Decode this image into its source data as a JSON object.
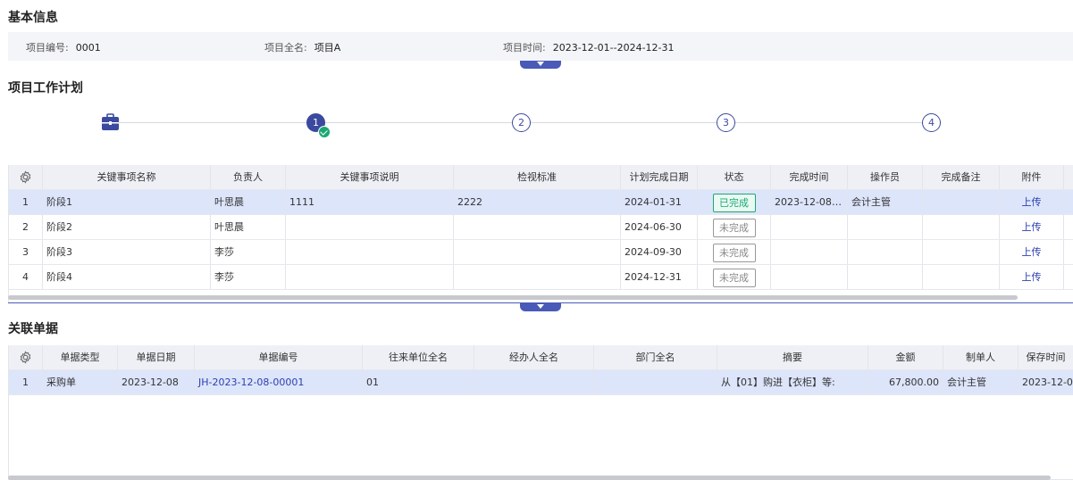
{
  "basic_info": {
    "title": "基本信息",
    "project_code_label": "项目编号:",
    "project_code": "0001",
    "project_name_label": "项目全名:",
    "project_name": "项目A",
    "project_time_label": "项目时间:",
    "project_time": "2023-12-01--2024-12-31"
  },
  "plan": {
    "title": "项目工作计划",
    "steps": [
      "1",
      "2",
      "3",
      "4"
    ],
    "columns": [
      "关键事项名称",
      "负责人",
      "关键事项说明",
      "检视标准",
      "计划完成日期",
      "状态",
      "完成时间",
      "操作员",
      "完成备注",
      "附件"
    ],
    "rows": [
      {
        "no": "1",
        "name": "阶段1",
        "owner": "叶思晨",
        "desc": "1111",
        "standard": "2222",
        "plan_date": "2024-01-31",
        "status": "已完成",
        "done_time": "2023-12-08 ...",
        "operator": "会计主管",
        "remark": "",
        "attach": "上传"
      },
      {
        "no": "2",
        "name": "阶段2",
        "owner": "叶思晨",
        "desc": "",
        "standard": "",
        "plan_date": "2024-06-30",
        "status": "未完成",
        "done_time": "",
        "operator": "",
        "remark": "",
        "attach": "上传"
      },
      {
        "no": "3",
        "name": "阶段3",
        "owner": "李莎",
        "desc": "",
        "standard": "",
        "plan_date": "2024-09-30",
        "status": "未完成",
        "done_time": "",
        "operator": "",
        "remark": "",
        "attach": "上传"
      },
      {
        "no": "4",
        "name": "阶段4",
        "owner": "李莎",
        "desc": "",
        "standard": "",
        "plan_date": "2024-12-31",
        "status": "未完成",
        "done_time": "",
        "operator": "",
        "remark": "",
        "attach": "上传"
      }
    ]
  },
  "docs": {
    "title": "关联单据",
    "columns": [
      "单据类型",
      "单据日期",
      "单据编号",
      "往来单位全名",
      "经办人全名",
      "部门全名",
      "摘要",
      "金额",
      "制单人",
      "保存时间"
    ],
    "rows": [
      {
        "no": "1",
        "type": "采购单",
        "date": "2023-12-08",
        "code": "JH-2023-12-08-00001",
        "partner": "01",
        "handler": "",
        "dept": "",
        "summary": "从【01】购进【衣柜】等:",
        "amount": "67,800.00",
        "maker": "会计主管",
        "save_time": "2023-12-0"
      }
    ]
  },
  "colors": {
    "primary": "#3b4a9e",
    "done": "#1aa872",
    "selected_row": "#dde5fb"
  }
}
